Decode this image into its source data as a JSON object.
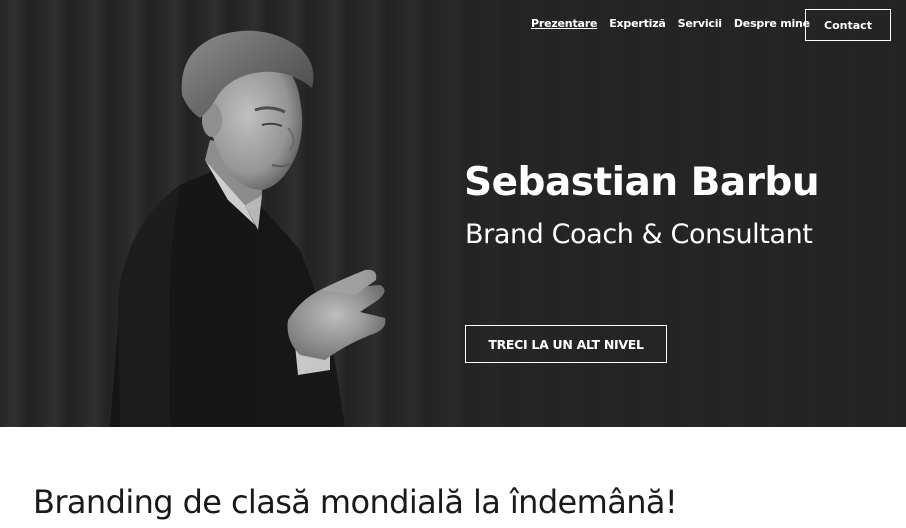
{
  "nav": {
    "items": [
      {
        "label": "Prezentare",
        "active": true
      },
      {
        "label": "Expertiză",
        "active": false
      },
      {
        "label": "Servicii",
        "active": false
      },
      {
        "label": "Despre mine",
        "active": false
      }
    ],
    "contact_label": "Contact"
  },
  "hero": {
    "name": "Sebastian Barbu",
    "subtitle": "Brand Coach & Consultant",
    "cta_label": "TRECI LA UN ALT NIVEL",
    "photo": "black-and-white portrait of man in suit clapping"
  },
  "section": {
    "title": "Branding de clasă mondială la îndemână!"
  },
  "colors": {
    "hero_bg": "#262626",
    "text_light": "#ffffff",
    "text_dark": "#1a1a1a",
    "page_bg": "#ffffff"
  }
}
